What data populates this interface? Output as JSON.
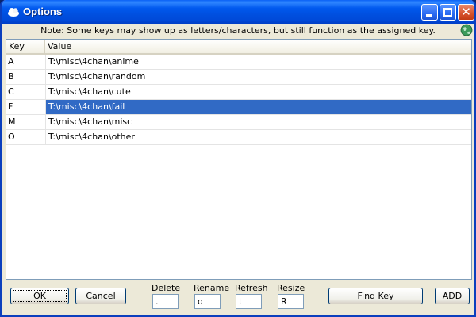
{
  "window": {
    "title": "Options",
    "icon": "cloud-app-icon",
    "controls": {
      "minimize": "minimize-icon",
      "maximize": "maximize-icon",
      "close": "close-icon"
    }
  },
  "note": "Note: Some keys may show up as letters/characters, but still function as the assigned key.",
  "list": {
    "columns": {
      "key": "Key",
      "value": "Value"
    },
    "rows": [
      {
        "key": "A",
        "value": "T:\\misc\\4chan\\anime",
        "selected": false
      },
      {
        "key": "B",
        "value": "T:\\misc\\4chan\\random",
        "selected": false
      },
      {
        "key": "C",
        "value": "T:\\misc\\4chan\\cute",
        "selected": false
      },
      {
        "key": "F",
        "value": "T:\\misc\\4chan\\fail",
        "selected": true
      },
      {
        "key": "M",
        "value": "T:\\misc\\4chan\\misc",
        "selected": false
      },
      {
        "key": "O",
        "value": "T:\\misc\\4chan\\other",
        "selected": false
      }
    ]
  },
  "bottom": {
    "ok_label": "OK",
    "cancel_label": "Cancel",
    "delete": {
      "label": "Delete",
      "value": "."
    },
    "rename": {
      "label": "Rename",
      "value": "q"
    },
    "refresh": {
      "label": "Refresh",
      "value": "t"
    },
    "resize": {
      "label": "Resize",
      "value": "R"
    },
    "find_key_label": "Find Key",
    "add_label": "ADD"
  },
  "colors": {
    "titlebar": "#0054e3",
    "selection": "#316ac5",
    "dialog": "#ece9d8"
  }
}
